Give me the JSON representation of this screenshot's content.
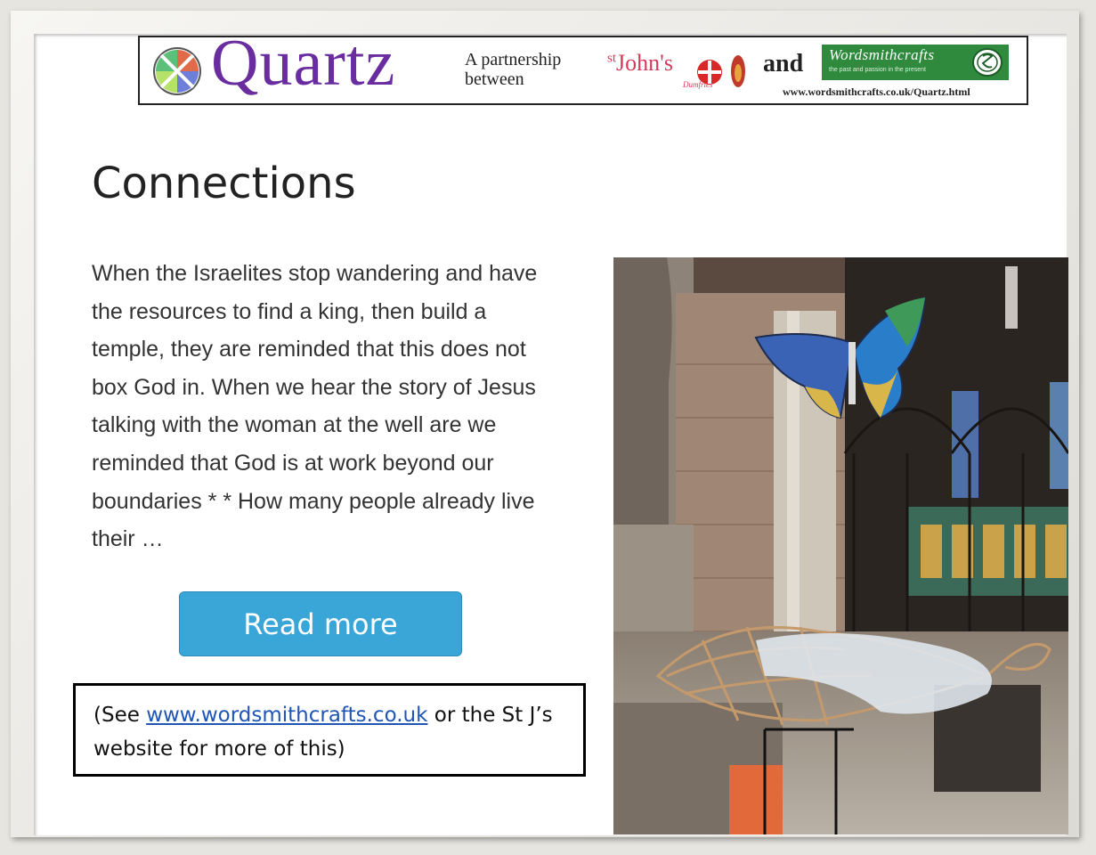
{
  "banner": {
    "logo_name": "Quartz",
    "partnership_line1": "A partnership",
    "partnership_line2": "between",
    "stjohns_prefix": "st",
    "stjohns_name": "John's",
    "stjohns_place": "Dumfries",
    "and": "and",
    "wordsmith_name": "Wordsmithcrafts",
    "wordsmith_tagline": "the past and passion in the present",
    "url": "www.wordsmithcrafts.co.uk/Quartz.html"
  },
  "article": {
    "title": "Connections",
    "body": "When the Israelites stop wandering and have the resources to find a king, then build a temple, they are reminded that this does not box God in. When we hear the story of Jesus talking with the woman at the well are we reminded that God is at work beyond our boundaries * * How many people already live their …",
    "read_more": "Read more"
  },
  "note": {
    "prefix": "(See ",
    "link": "www.wordsmithcrafts.co.uk",
    "suffix": " or the St J’s website for more of this)"
  },
  "colors": {
    "quartz_purple": "#6a2da0",
    "button_blue": "#3aa6d8",
    "wordsmith_green": "#2f8a3e",
    "link_blue": "#1f55b5"
  }
}
